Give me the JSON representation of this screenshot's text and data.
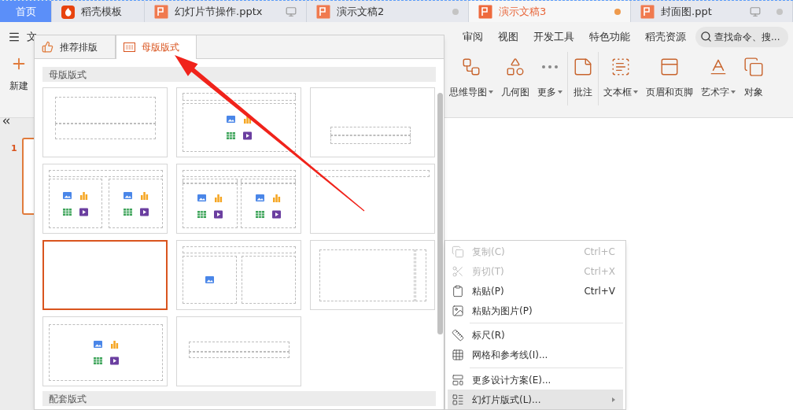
{
  "tabs": [
    {
      "label": "首页",
      "kind": "home",
      "selected": false
    },
    {
      "label": "稻壳模板",
      "kind": "template",
      "selected": false
    },
    {
      "label": "幻灯片节操作.pptx",
      "kind": "doc",
      "selected": false,
      "monitor": true,
      "dot": false
    },
    {
      "label": "演示文稿2",
      "kind": "doc",
      "selected": false,
      "monitor": false,
      "dot": true
    },
    {
      "label": "演示文稿3",
      "kind": "doc",
      "selected": true,
      "monitor": false,
      "dot": true
    },
    {
      "label": "封面图.ppt",
      "kind": "doc",
      "selected": false,
      "monitor": true,
      "dot": true
    }
  ],
  "menu_button": "文",
  "ribbon_tabs": [
    "审阅",
    "视图",
    "开发工具",
    "特色功能",
    "稻壳资源"
  ],
  "search": {
    "placeholder": "查找命令、搜..."
  },
  "new_slide": {
    "label": "新建"
  },
  "ribbon_groups": [
    [
      {
        "label": "思维导图",
        "dropdown": true
      },
      {
        "label": "几何图",
        "dropdown": false
      },
      {
        "label": "更多",
        "dropdown": true
      }
    ],
    [
      {
        "label": "批注",
        "dropdown": false
      }
    ],
    [
      {
        "label": "文本框",
        "dropdown": true
      },
      {
        "label": "页眉和页脚",
        "dropdown": false
      },
      {
        "label": "艺术字",
        "dropdown": true
      },
      {
        "label": "对象",
        "dropdown": false
      }
    ]
  ],
  "slides": [
    {
      "number": "1",
      "selected": true
    }
  ],
  "layout_panel": {
    "tabs": [
      {
        "label": "推荐排版",
        "selected": false
      },
      {
        "label": "母版版式",
        "selected": true
      }
    ],
    "sections": [
      {
        "title": "母版版式",
        "layouts": [
          {
            "kind": "title-slide",
            "selected": false
          },
          {
            "kind": "title-content",
            "selected": false
          },
          {
            "kind": "section",
            "selected": false
          },
          {
            "kind": "two-content",
            "selected": false
          },
          {
            "kind": "comparison",
            "selected": false
          },
          {
            "kind": "title-only",
            "selected": false
          },
          {
            "kind": "blank",
            "selected": true
          },
          {
            "kind": "picture-caption",
            "selected": false
          },
          {
            "kind": "vertical",
            "selected": false
          },
          {
            "kind": "content",
            "selected": false
          },
          {
            "kind": "caption",
            "selected": false
          }
        ]
      },
      {
        "title": "配套版式"
      }
    ]
  },
  "context_menu": [
    {
      "kind": "item",
      "label": "复制(C)",
      "shortcut": "Ctrl+C",
      "disabled": true,
      "selected": false,
      "submenu": false
    },
    {
      "kind": "item",
      "label": "剪切(T)",
      "shortcut": "Ctrl+X",
      "disabled": true,
      "selected": false,
      "submenu": false
    },
    {
      "kind": "item",
      "label": "粘贴(P)",
      "shortcut": "Ctrl+V",
      "disabled": false,
      "selected": false,
      "submenu": false
    },
    {
      "kind": "item",
      "label": "粘贴为图片(P)",
      "disabled": false,
      "selected": false,
      "submenu": false
    },
    {
      "kind": "separator"
    },
    {
      "kind": "item",
      "label": "标尺(R)",
      "disabled": false,
      "selected": false,
      "submenu": false
    },
    {
      "kind": "item",
      "label": "网格和参考线(I)...",
      "disabled": false,
      "selected": false,
      "submenu": false
    },
    {
      "kind": "separator"
    },
    {
      "kind": "item",
      "label": "更多设计方案(E)...",
      "disabled": false,
      "selected": false,
      "submenu": false
    },
    {
      "kind": "item",
      "label": "幻灯片版式(L)...",
      "disabled": false,
      "selected": true,
      "submenu": true
    }
  ]
}
